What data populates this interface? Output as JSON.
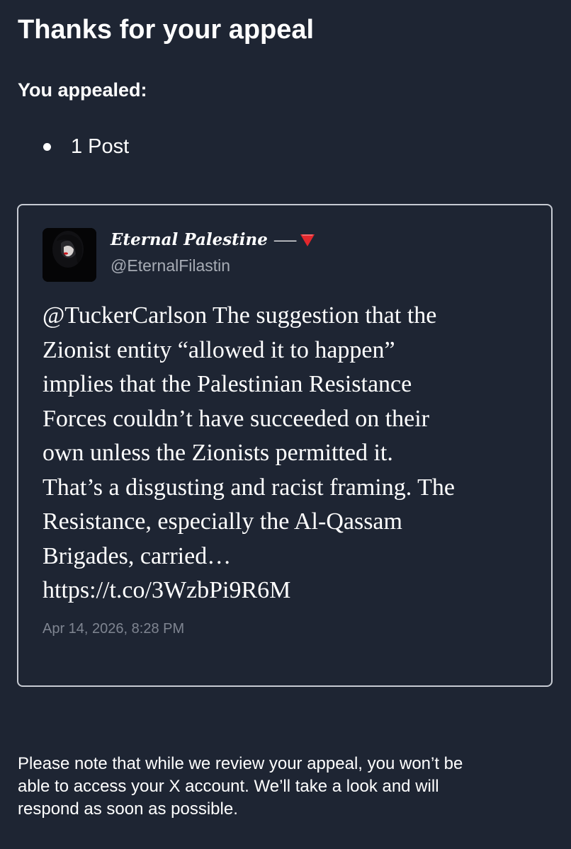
{
  "page": {
    "title": "Thanks for your appeal",
    "appealed_heading": "You appealed:",
    "appealed_items": [
      "1 Post"
    ]
  },
  "post": {
    "display_name": "Eternal Palestine",
    "name_glyph": "⸺",
    "handle": "@EternalFilastin",
    "text_lines": [
      "@TuckerCarlson The suggestion that the",
      "Zionist entity “allowed it to happen”",
      "implies that the Palestinian Resistance",
      "Forces couldn’t have succeeded on their",
      "own unless the Zionists permitted it.",
      "That’s a disgusting and racist framing. The",
      "Resistance, especially the Al-Qassam",
      "Brigades, carried…",
      "https://t.co/3WzbPi9R6M"
    ],
    "timestamp": "Apr 14, 2026, 8:28 PM",
    "icons": {
      "flag": "red-triangle-icon",
      "avatar": "avatar"
    }
  },
  "note_lines": [
    "Please note that while we review your appeal, you won’t be",
    "able to access your X account. We’ll take a look and will",
    "respond as soon as possible."
  ],
  "colors": {
    "background": "#1e2533",
    "card_border": "#c7cbd3",
    "handle": "#a7acb5",
    "timestamp": "#7f8591",
    "flag_red": "#e2272c"
  }
}
